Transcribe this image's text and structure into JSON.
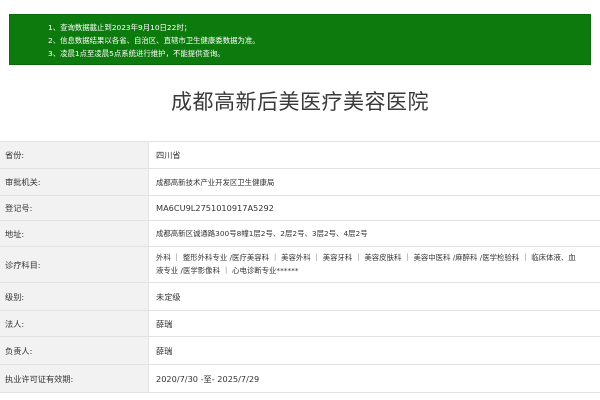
{
  "notice": {
    "lines": [
      "1、查询数据截止到2023年9月10日22时；",
      "2、信息数据结果以各省、自治区、直辖市卫生健康委数据为准。",
      "3、凌晨1点至凌晨5点系统进行维护，不能提供查询。"
    ],
    "background_color": "#0d7a0d"
  },
  "title": "成都高新后美医疗美容医院",
  "fields": [
    {
      "label": "省份:",
      "value": "四川省"
    },
    {
      "label": "审批机关:",
      "value": "成都高新技术产业开发区卫生健康局"
    },
    {
      "label": "登记号:",
      "value": "MA6CU9L2751010917A5292"
    },
    {
      "label": "地址:",
      "value": "成都高新区诚通路300号8幢1层2号、2层2号、3层2号、4层2号"
    },
    {
      "label": "诊疗科目:",
      "value": "外科 ｜ 整形外科专业 /医疗美容科 ｜ 美容外科 ｜ 美容牙科 ｜ 美容皮肤科 ｜ 美容中医科 /麻醉科 /医学检验科 ｜ 临床体液、血液专业 /医学影像科 ｜ 心电诊断专业******"
    },
    {
      "label": "级别:",
      "value": "未定级"
    },
    {
      "label": "法人:",
      "value": "薛瑞"
    },
    {
      "label": "负责人:",
      "value": "薛瑞"
    },
    {
      "label": "执业许可证有效期:",
      "value": "2020/7/30 -至- 2025/7/29"
    }
  ]
}
